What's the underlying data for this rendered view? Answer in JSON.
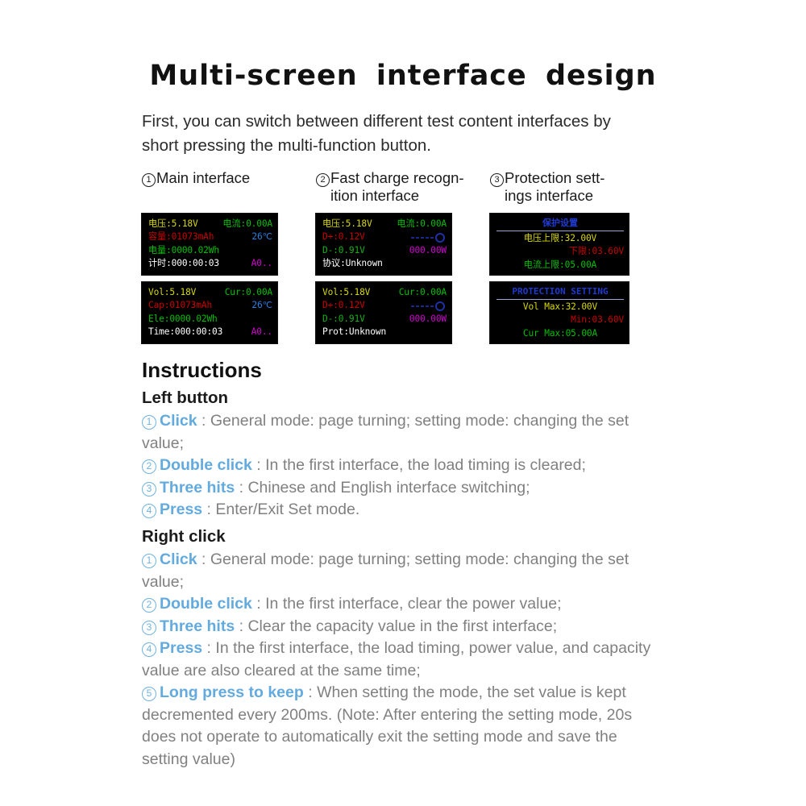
{
  "title": "Multi-screen  interface  design",
  "intro": "First, you can switch between different test content interfaces by short pressing the multi-function button.",
  "columns": [
    {
      "number": "1",
      "heading_line1": "Main interface",
      "heading_line2": "",
      "screens": [
        {
          "lang": "zh",
          "rows": [
            {
              "cells": [
                {
                  "text": "电压:5.18V",
                  "color": "#d8d800"
                },
                {
                  "text": "电流:0.00A",
                  "color": "#00c000"
                }
              ]
            },
            {
              "cells": [
                {
                  "text": "容量:01073mAh",
                  "color": "#c80000"
                },
                {
                  "text": "26℃",
                  "color": "#2a7fe0"
                }
              ]
            },
            {
              "cells": [
                {
                  "text": "电量:0000.02Wh",
                  "color": "#00c000"
                }
              ]
            },
            {
              "cells": [
                {
                  "text": "计时:000:00:03",
                  "color": "#ffffff"
                },
                {
                  "text": "A0..",
                  "color": "#d000d0"
                }
              ]
            }
          ]
        },
        {
          "lang": "en",
          "rows": [
            {
              "cells": [
                {
                  "text": "Vol:5.18V",
                  "color": "#d8d800"
                },
                {
                  "text": "Cur:0.00A",
                  "color": "#00c000"
                }
              ]
            },
            {
              "cells": [
                {
                  "text": "Cap:01073mAh",
                  "color": "#c80000"
                },
                {
                  "text": "26℃",
                  "color": "#2a7fe0"
                }
              ]
            },
            {
              "cells": [
                {
                  "text": "Ele:0000.02Wh",
                  "color": "#00c000"
                }
              ]
            },
            {
              "cells": [
                {
                  "text": "Time:000:00:03",
                  "color": "#ffffff"
                },
                {
                  "text": "A0..",
                  "color": "#d000d0"
                }
              ]
            }
          ]
        }
      ]
    },
    {
      "number": "2",
      "heading_line1": "Fast charge recogn-",
      "heading_line2": "ition interface",
      "screens": [
        {
          "lang": "zh",
          "rows": [
            {
              "cells": [
                {
                  "text": "电压:5.18V",
                  "color": "#d8d800"
                },
                {
                  "text": "电流:0.00A",
                  "color": "#00c000"
                }
              ]
            },
            {
              "cells": [
                {
                  "text": "D+:0.12V",
                  "color": "#c80000"
                },
                {
                  "text": "",
                  "color": "#1a2a88",
                  "icon": "dashed-line-circle"
                }
              ]
            },
            {
              "cells": [
                {
                  "text": "D-:0.91V",
                  "color": "#18b018"
                },
                {
                  "text": "000.00W",
                  "color": "#d000d0"
                }
              ]
            },
            {
              "cells": [
                {
                  "text": "协议:Unknown",
                  "color": "#ffffff"
                }
              ]
            }
          ]
        },
        {
          "lang": "en",
          "rows": [
            {
              "cells": [
                {
                  "text": "Vol:5.18V",
                  "color": "#d8d800"
                },
                {
                  "text": "Cur:0.00A",
                  "color": "#00c000"
                }
              ]
            },
            {
              "cells": [
                {
                  "text": "D+:0.12V",
                  "color": "#c80000"
                },
                {
                  "text": "",
                  "color": "#1a2a88",
                  "icon": "dashed-line-circle"
                }
              ]
            },
            {
              "cells": [
                {
                  "text": "D-:0.91V",
                  "color": "#18b018"
                },
                {
                  "text": "000.00W",
                  "color": "#d000d0"
                }
              ]
            },
            {
              "cells": [
                {
                  "text": "Prot:Unknown",
                  "color": "#ffffff"
                }
              ]
            }
          ]
        }
      ]
    },
    {
      "number": "3",
      "heading_line1": "Protection sett-",
      "heading_line2": "ings interface",
      "screens": [
        {
          "lang": "zh",
          "header": "保护设置",
          "rows": [
            {
              "align": "center",
              "cells": [
                {
                  "text": "电压上限:32.00V",
                  "color": "#d8d800"
                }
              ]
            },
            {
              "align": "right",
              "cells": [
                {
                  "text": "下限:03.60V",
                  "color": "#c80000"
                }
              ]
            },
            {
              "align": "center",
              "cells": [
                {
                  "text": "电流上限:05.00A",
                  "color": "#00c000"
                }
              ]
            }
          ]
        },
        {
          "lang": "en",
          "header": "PROTECTION SETTING",
          "rows": [
            {
              "align": "center",
              "cells": [
                {
                  "text": "Vol Max:32.00V",
                  "color": "#d8d800"
                }
              ]
            },
            {
              "align": "right",
              "cells": [
                {
                  "text": "Min:03.60V",
                  "color": "#c80000"
                }
              ]
            },
            {
              "align": "center",
              "cells": [
                {
                  "text": "Cur Max:05.00A",
                  "color": "#00c000"
                }
              ]
            }
          ]
        }
      ]
    }
  ],
  "instructions": {
    "title": "Instructions",
    "sections": [
      {
        "heading": "Left button",
        "items": [
          {
            "num": "1",
            "label": "Click",
            "text": "General mode: page turning; setting mode: changing the set value;"
          },
          {
            "num": "2",
            "label": "Double click",
            "text": "In the first interface, the load timing is cleared;"
          },
          {
            "num": "3",
            "label": "Three hits",
            "text": "Chinese and English interface switching;"
          },
          {
            "num": "4",
            "label": "Press",
            "text": "Enter/Exit Set mode."
          }
        ]
      },
      {
        "heading": "Right click",
        "items": [
          {
            "num": "1",
            "label": "Click",
            "text": "General mode: page turning; setting mode: changing the set value;"
          },
          {
            "num": "2",
            "label": "Double click",
            "text": "In the first interface, clear the power value;"
          },
          {
            "num": "3",
            "label": "Three hits",
            "text": "Clear the capacity value in the first interface;"
          },
          {
            "num": "4",
            "label": "Press",
            "text": "In the first interface, the load timing, power value, and capacity value are also cleared at the same time;"
          },
          {
            "num": "5",
            "label": "Long press to keep",
            "text": "When setting the mode, the set value is kept decremented every 200ms. (Note: After entering the setting mode, 20s does not operate to automatically exit the setting mode and save the setting value)"
          }
        ]
      }
    ]
  },
  "colors": {
    "accent_blue": "#63aade",
    "body_gray": "#808080",
    "lcd_background": "#000000",
    "lcd_title_blue": "#1f3ad0"
  }
}
